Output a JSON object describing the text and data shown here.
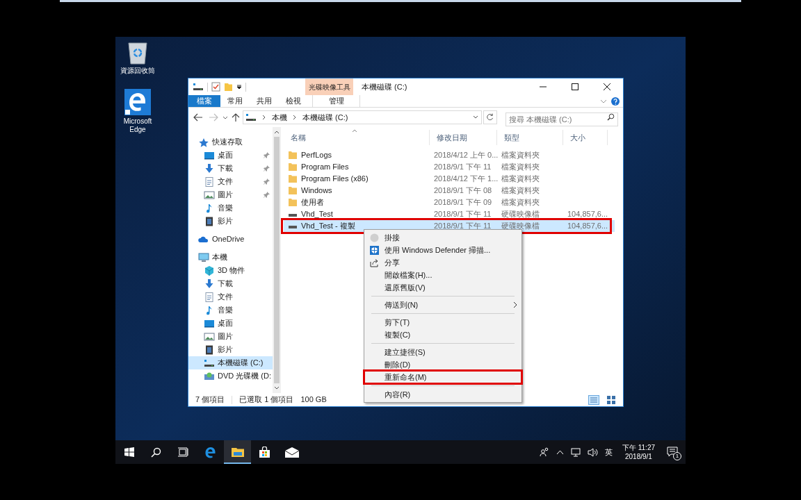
{
  "desktop_icons": [
    {
      "label": "資源回收筒",
      "kind": "recycle"
    },
    {
      "label": "Microsoft Edge",
      "kind": "edge"
    }
  ],
  "window": {
    "title": "本機磁碟 (C:)",
    "tool_group": "光碟映像工具",
    "ribbon_tabs": [
      {
        "label": "檔案",
        "kind": "file"
      },
      {
        "label": "常用",
        "kind": "normal"
      },
      {
        "label": "共用",
        "kind": "normal"
      },
      {
        "label": "檢視",
        "kind": "normal"
      },
      {
        "label": "管理",
        "kind": "contextual"
      }
    ],
    "address": [
      "本機",
      "本機磁碟 (C:)"
    ],
    "search": {
      "placeholder": "搜尋 本機磁碟 (C:)"
    },
    "sidebar": [
      {
        "label": "快速存取",
        "kind": "star",
        "selected": false,
        "children": [
          {
            "label": "桌面",
            "kind": "desktop",
            "pinned": true,
            "selected": false
          },
          {
            "label": "下載",
            "kind": "download",
            "pinned": true,
            "selected": false
          },
          {
            "label": "文件",
            "kind": "document",
            "pinned": true,
            "selected": false
          },
          {
            "label": "圖片",
            "kind": "picture",
            "pinned": true,
            "selected": false
          },
          {
            "label": "音樂",
            "kind": "music",
            "pinned": false,
            "selected": false
          },
          {
            "label": "影片",
            "kind": "video",
            "pinned": false,
            "selected": false
          }
        ]
      },
      {
        "label": "OneDrive",
        "kind": "cloud",
        "selected": false
      },
      {
        "label": "本機",
        "kind": "pc",
        "selected": false,
        "children": [
          {
            "label": "3D 物件",
            "kind": "cube",
            "selected": false
          },
          {
            "label": "下載",
            "kind": "download",
            "selected": false
          },
          {
            "label": "文件",
            "kind": "document",
            "selected": false
          },
          {
            "label": "音樂",
            "kind": "music",
            "selected": false
          },
          {
            "label": "桌面",
            "kind": "desktop",
            "selected": false
          },
          {
            "label": "圖片",
            "kind": "picture",
            "selected": false
          },
          {
            "label": "影片",
            "kind": "video",
            "selected": false
          },
          {
            "label": "本機磁碟 (C:)",
            "kind": "drive",
            "selected": true
          },
          {
            "label": "DVD 光碟機 (D:",
            "kind": "dvd",
            "selected": false
          }
        ]
      }
    ],
    "columns": [
      "名稱",
      "修改日期",
      "類型",
      "大小"
    ],
    "rows": [
      {
        "name": "PerfLogs",
        "date": "2018/4/12 上午 0...",
        "type": "檔案資料夾",
        "size": "",
        "kind": "folder",
        "selected": false,
        "annotated": false
      },
      {
        "name": "Program Files",
        "date": "2018/9/1 下午 11",
        "type": "檔案資料夾",
        "size": "",
        "kind": "folder",
        "selected": false,
        "annotated": false
      },
      {
        "name": "Program Files (x86)",
        "date": "2018/4/12 下午 1...",
        "type": "檔案資料夾",
        "size": "",
        "kind": "folder",
        "selected": false,
        "annotated": false
      },
      {
        "name": "Windows",
        "date": "2018/9/1 下午 08",
        "type": "檔案資料夾",
        "size": "",
        "kind": "folder",
        "selected": false,
        "annotated": false
      },
      {
        "name": "使用者",
        "date": "2018/9/1 下午 09",
        "type": "檔案資料夾",
        "size": "",
        "kind": "folder",
        "selected": false,
        "annotated": false
      },
      {
        "name": "Vhd_Test",
        "date": "2018/9/1 下午 11",
        "type": "硬碟映像檔",
        "size": "104,857,6...",
        "kind": "disk",
        "selected": false,
        "annotated": false
      },
      {
        "name": "Vhd_Test - 複製",
        "date": "2018/9/1 下午 11",
        "type": "硬碟映像檔",
        "size": "104,857,6...",
        "kind": "disk",
        "selected": true,
        "annotated": true
      }
    ],
    "status_bar": {
      "count": "7 個項目",
      "selection": "已選取 1 個項目",
      "size": "100 GB"
    },
    "context_menu": [
      {
        "kind": "mount",
        "label": "掛接",
        "annotated": false
      },
      {
        "kind": "scan",
        "label": "使用 Windows Defender 掃描...",
        "annotated": false
      },
      {
        "kind": "share",
        "label": "分享",
        "annotated": false
      },
      {
        "kind": "item",
        "label": "開啟檔案(H)...",
        "annotated": false
      },
      {
        "kind": "item",
        "label": "還原舊版(V)",
        "annotated": false
      },
      {
        "kind": "separator"
      },
      {
        "kind": "item",
        "label": "傳送到(N)",
        "submenu": true,
        "annotated": false
      },
      {
        "kind": "separator"
      },
      {
        "kind": "item",
        "label": "剪下(T)",
        "annotated": false
      },
      {
        "kind": "item",
        "label": "複製(C)",
        "annotated": false
      },
      {
        "kind": "separator"
      },
      {
        "kind": "item",
        "label": "建立捷徑(S)",
        "annotated": false
      },
      {
        "kind": "item",
        "label": "刪除(D)",
        "annotated": false
      },
      {
        "kind": "item",
        "label": "重新命名(M)",
        "annotated": true
      },
      {
        "kind": "separator"
      },
      {
        "kind": "item",
        "label": "內容(R)",
        "annotated": false
      }
    ]
  },
  "taskbar": {
    "apps": [
      {
        "kind": "start"
      },
      {
        "kind": "search"
      },
      {
        "kind": "taskview"
      },
      {
        "kind": "edge",
        "active": false
      },
      {
        "kind": "explorer",
        "active": true
      },
      {
        "kind": "store",
        "active": false
      },
      {
        "kind": "mail",
        "active": false
      }
    ],
    "ime": "英",
    "time": "下午 11:27",
    "date": "2018/9/1",
    "notifications": "1"
  }
}
